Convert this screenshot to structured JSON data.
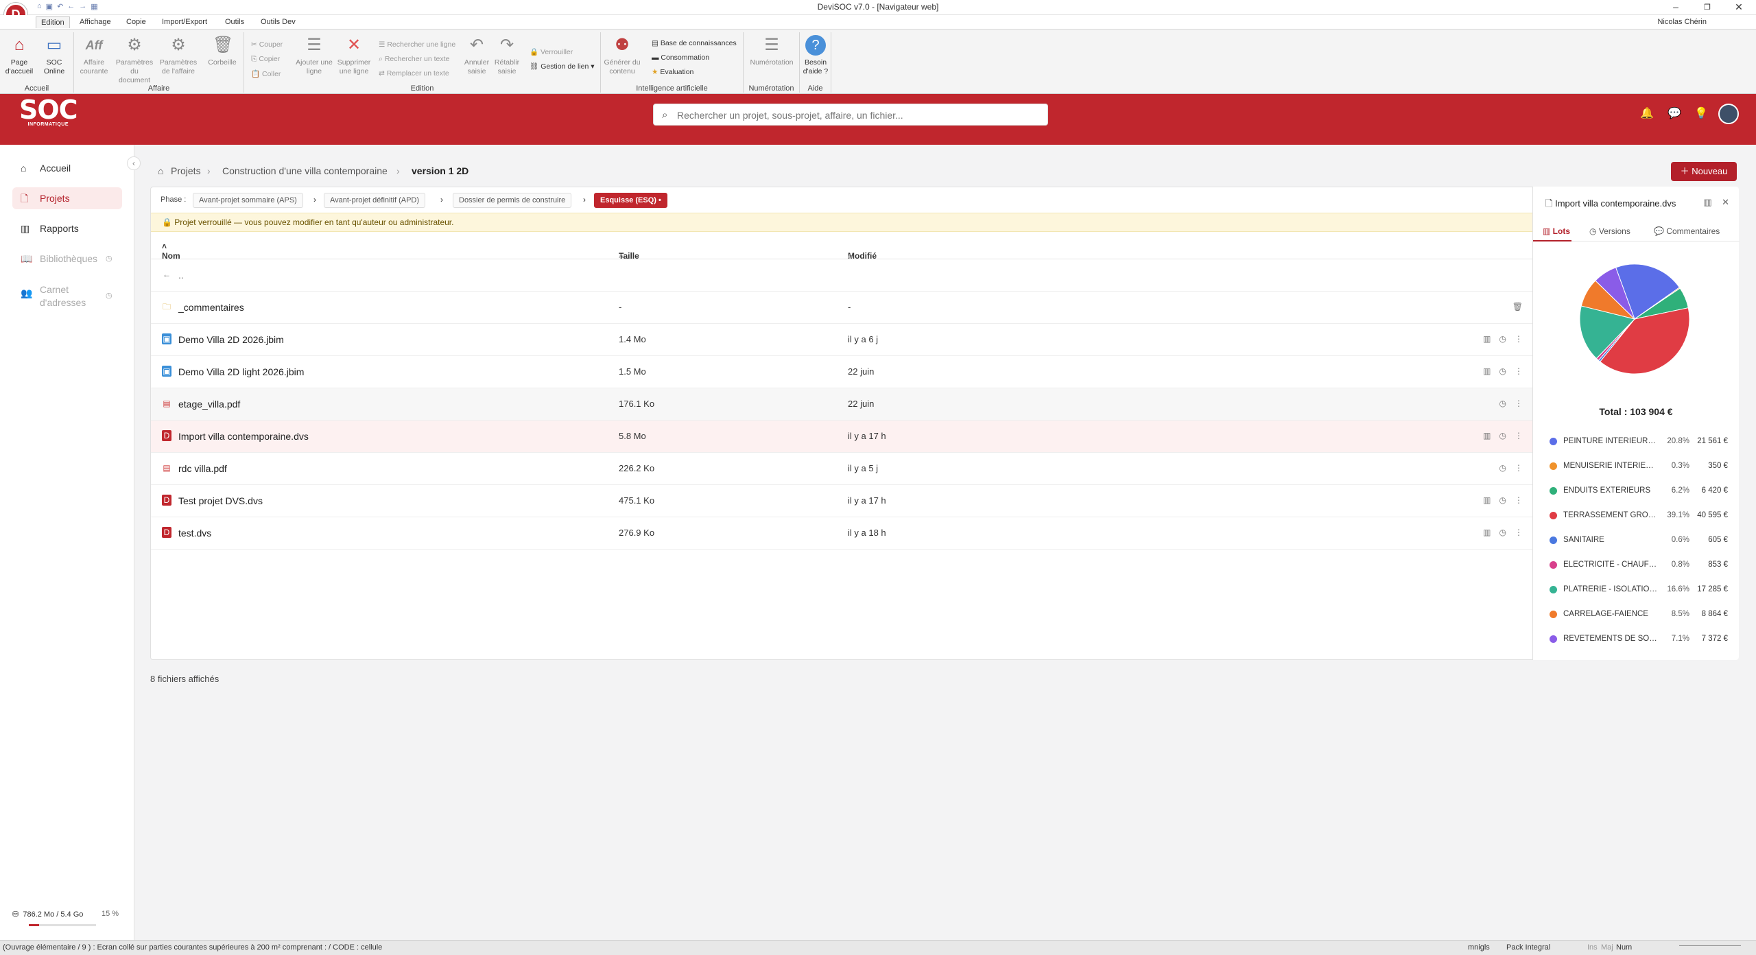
{
  "window": {
    "title": "DeviSOC v7.0 - [Navigateur web]",
    "user": "Nicolas Chérin"
  },
  "ribbon_tabs": [
    "Edition",
    "Affichage",
    "Copie",
    "Import/Export",
    "Outils",
    "Outils Dev"
  ],
  "ribbon": {
    "accueil": {
      "label": "Accueil",
      "home": "Page d'accueil",
      "soc": "SOC Online"
    },
    "affaire": {
      "label": "Affaire",
      "courante": "Affaire courante",
      "param_doc": "Paramètres du document",
      "param_aff": "Paramètres de l'affaire",
      "corbeille": "Corbeille"
    },
    "edition": {
      "label": "Edition",
      "couper": "Couper",
      "copier": "Copier",
      "coller": "Coller",
      "ajouter": "Ajouter une ligne",
      "supprimer": "Supprimer une ligne",
      "rech_ligne": "Rechercher une ligne",
      "rech_texte": "Rechercher un texte",
      "remplacer": "Remplacer un texte",
      "annuler": "Annuler saisie",
      "retablir": "Rétablir saisie",
      "verrouiller": "Verrouiller",
      "gestion_lien": "Gestion de lien"
    },
    "ia": {
      "label": "Intelligence artificielle",
      "generer": "Générer du contenu",
      "base": "Base de connaissances",
      "conso": "Consommation",
      "eval": "Evaluation"
    },
    "numerotation": {
      "label": "Numérotation",
      "btn": "Numérotation"
    },
    "aide": {
      "label": "Aide",
      "btn": "Besoin d'aide ?"
    }
  },
  "header": {
    "logo": "SOC",
    "logo_sub": "INFORMATIQUE",
    "search_placeholder": "Rechercher un projet, sous-projet, affaire, un fichier..."
  },
  "sidebar": {
    "items": [
      {
        "label": "Accueil",
        "icon": "home-icon"
      },
      {
        "label": "Projets",
        "icon": "file-icon"
      },
      {
        "label": "Rapports",
        "icon": "chart-icon"
      },
      {
        "label": "Bibliothèques",
        "icon": "book-icon"
      },
      {
        "label": "Carnet d'adresses",
        "icon": "contacts-icon"
      }
    ],
    "storage": "786.2 Mo / 5.4 Go",
    "storage_pct": "15 %",
    "storage_fraction": 0.15
  },
  "breadcrumb": {
    "root": "Projets",
    "project": "Construction d'une villa contemporaine",
    "current": "version 1 2D"
  },
  "new_button": "Nouveau",
  "phase": {
    "label": "Phase :",
    "steps": [
      "Avant-projet sommaire (APS)",
      "Avant-projet définitif (APD)",
      "Dossier de permis de construire",
      "Esquisse (ESQ) •"
    ]
  },
  "lock_message": "Projet verrouillé — vous pouvez modifier en tant qu'auteur ou administrateur.",
  "table": {
    "headers": {
      "name": "Nom",
      "size": "Taille",
      "modified": "Modifié"
    },
    "back": "..",
    "rows": [
      {
        "name": "_commentaires",
        "size": "-",
        "modified": "-",
        "type": "folder"
      },
      {
        "name": "Demo Villa 2D 2026.jbim",
        "size": "1.4 Mo",
        "modified": "il y a 6 j",
        "type": "jbim"
      },
      {
        "name": "Demo Villa 2D light 2026.jbim",
        "size": "1.5 Mo",
        "modified": "22 juin",
        "type": "jbim"
      },
      {
        "name": "etage_villa.pdf",
        "size": "176.1 Ko",
        "modified": "22 juin",
        "type": "pdf"
      },
      {
        "name": "Import villa contemporaine.dvs",
        "size": "5.8 Mo",
        "modified": "il y a 17 h",
        "type": "dvs"
      },
      {
        "name": "rdc villa.pdf",
        "size": "226.2 Ko",
        "modified": "il y a 5 j",
        "type": "pdf"
      },
      {
        "name": "Test projet DVS.dvs",
        "size": "475.1 Ko",
        "modified": "il y a 17 h",
        "type": "dvs"
      },
      {
        "name": "test.dvs",
        "size": "276.9 Ko",
        "modified": "il y a 18 h",
        "type": "dvs"
      }
    ]
  },
  "file_count": "8 fichiers affichés",
  "details": {
    "title": "Import villa contemporaine.dvs",
    "tabs": [
      "Lots",
      "Versions",
      "Commentaires"
    ],
    "total": "Total : 103 904 €"
  },
  "chart_data": {
    "type": "pie",
    "slices": [
      {
        "name": "PEINTURE INTERIEURE E...",
        "percent": 20.8,
        "value": "21 561 €",
        "color": "#5b6ee8"
      },
      {
        "name": "MENUISERIE INTERIEURE",
        "percent": 0.3,
        "value": "350 €",
        "color": "#f0922b"
      },
      {
        "name": "ENDUITS EXTERIEURS",
        "percent": 6.2,
        "value": "6 420 €",
        "color": "#2fb07a"
      },
      {
        "name": "TERRASSEMENT GROS-...",
        "percent": 39.1,
        "value": "40 595 €",
        "color": "#e03c44"
      },
      {
        "name": "SANITAIRE",
        "percent": 0.6,
        "value": "605 €",
        "color": "#4a78e0"
      },
      {
        "name": "ELECTRICITE - CHAUFFAGE E...",
        "percent": 0.8,
        "value": "853 €",
        "color": "#d8408c"
      },
      {
        "name": "PLATRERIE - ISOLATION ...",
        "percent": 16.6,
        "value": "17 285 €",
        "color": "#35b393"
      },
      {
        "name": "CARRELAGE-FAIENCE",
        "percent": 8.5,
        "value": "8 864 €",
        "color": "#f07a2b"
      },
      {
        "name": "REVETEMENTS DE SOLS",
        "percent": 7.1,
        "value": "7 372 €",
        "color": "#8a5ce8"
      }
    ]
  },
  "status": {
    "left": "(Ouvrage élémentaire / 9 ) : Ecran collé sur parties courantes supérieures à 200 m² comprenant : / CODE : cellule",
    "user": "mnigls",
    "pack": "Pack Integral",
    "num": "Num",
    "ins": "Ins",
    "maj": "Maj"
  }
}
